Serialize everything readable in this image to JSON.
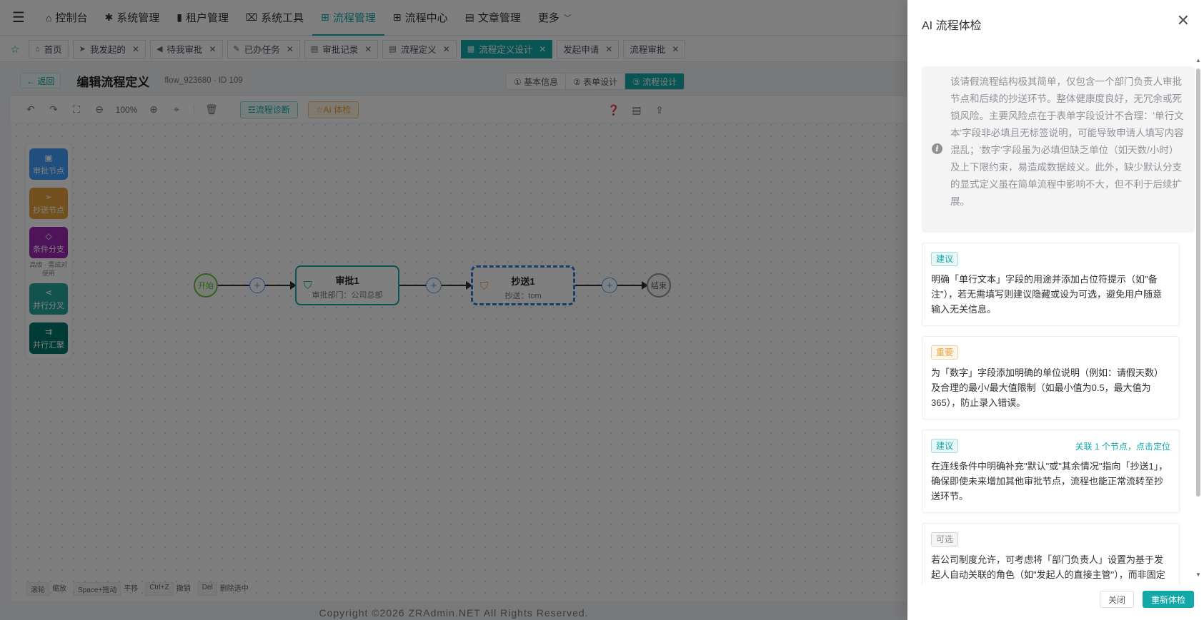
{
  "topnav": [
    {
      "icon": "⌂",
      "label": "控制台",
      "active": false
    },
    {
      "icon": "✱",
      "label": "系统管理",
      "active": false
    },
    {
      "icon": "▮",
      "label": "租户管理",
      "active": false
    },
    {
      "icon": "⌧",
      "label": "系统工具",
      "active": false
    },
    {
      "icon": "⊞",
      "label": "流程管理",
      "active": true
    },
    {
      "icon": "⊞",
      "label": "流程中心",
      "active": false
    },
    {
      "icon": "▤",
      "label": "文章管理",
      "active": false
    }
  ],
  "topnav_more": "更多",
  "tags": [
    {
      "label": "首页",
      "closable": false,
      "active": false
    },
    {
      "label": "我发起的",
      "closable": true,
      "active": false
    },
    {
      "label": "待我审批",
      "closable": true,
      "active": false
    },
    {
      "label": "已办任务",
      "closable": true,
      "active": false
    },
    {
      "label": "审批记录",
      "closable": true,
      "active": false
    },
    {
      "label": "流程定义",
      "closable": true,
      "active": false
    },
    {
      "label": "流程定义设计",
      "closable": true,
      "active": true
    },
    {
      "label": "发起申请",
      "closable": true,
      "active": false
    },
    {
      "label": "流程审批",
      "closable": true,
      "active": false
    }
  ],
  "page": {
    "back_label": "← 返回",
    "title": "编辑流程定义",
    "flow_id": "flow_923680 · ID 109",
    "steps": [
      "① 基本信息",
      "② 表单设计",
      "③ 流程设计"
    ]
  },
  "toolbar": {
    "zoom": "100%",
    "diagnose_label": "☲流程诊断",
    "ai_label": "☆AI 体检"
  },
  "palette": {
    "approve": "审批节点",
    "cc": "抄送节点",
    "condition": "条件分支",
    "condition_note": "高级 · 需成对使用",
    "parallel": "并行分叉",
    "join": "并行汇聚"
  },
  "flow": {
    "start": "开始",
    "end": "结束",
    "approve_title": "审批1",
    "approve_sub": "审批部门：公司总部",
    "cc_title": "抄送1",
    "cc_sub": "抄送：tom"
  },
  "shortcuts": [
    {
      "key": "滚轮",
      "label": "缩放"
    },
    {
      "key": "Space+拖动",
      "label": "平移"
    },
    {
      "key": "Ctrl+Z",
      "label": "撤销"
    },
    {
      "key": "Del",
      "label": "删除选中"
    }
  ],
  "footer": "Copyright ©2026 ZRAdmin.NET All Rights Reserved.",
  "drawer": {
    "title": "AI 流程体检",
    "summary": "该请假流程结构极其简单，仅包含一个部门负责人审批节点和后续的抄送环节。整体健康度良好，无冗余或死锁风险。主要风险点在于表单字段设计不合理：'单行文本'字段非必填且无标签说明，可能导致申请人填写内容混乱；'数字'字段虽为必填但缺乏单位（如天数/小时）及上下限约束，易造成数据歧义。此外，缺少默认分支的显式定义虽在简单流程中影响不大，但不利于后续扩展。",
    "cards": [
      {
        "badge": "建议",
        "level": "suggest",
        "link": "",
        "text": "明确「单行文本」字段的用途并添加占位符提示（如\"备注\"），若无需填写则建议隐藏或设为可选，避免用户随意输入无关信息。"
      },
      {
        "badge": "重要",
        "level": "important",
        "link": "",
        "text": "为「数字」字段添加明确的单位说明（例如：请假天数）及合理的最小/最大值限制（如最小值为0.5，最大值为365），防止录入错误。"
      },
      {
        "badge": "建议",
        "level": "suggest",
        "link": "关联 1 个节点，点击定位",
        "text": "在连线条件中明确补充\"默认\"或\"其余情况\"指向「抄送1」，确保即使未来增加其他审批节点，流程也能正常流转至抄送环节。"
      },
      {
        "badge": "可选",
        "level": "optional",
        "link": "",
        "text": "若公司制度允许，可考虑将「部门负责人」设置为基于发起人自动关联的角色（如\"发起人的直接主管\"），而非固定指定某一人，以提高流程适应性。"
      }
    ],
    "close_label": "关闭",
    "recheck_label": "重新体检"
  },
  "colors": {
    "accent": "#13a8a8",
    "approve_node": "#409eff",
    "cc_node": "#e6a23c",
    "condition_node": "#9c27b0",
    "parallel_node": "#26a69a",
    "join_node": "#00796b"
  }
}
